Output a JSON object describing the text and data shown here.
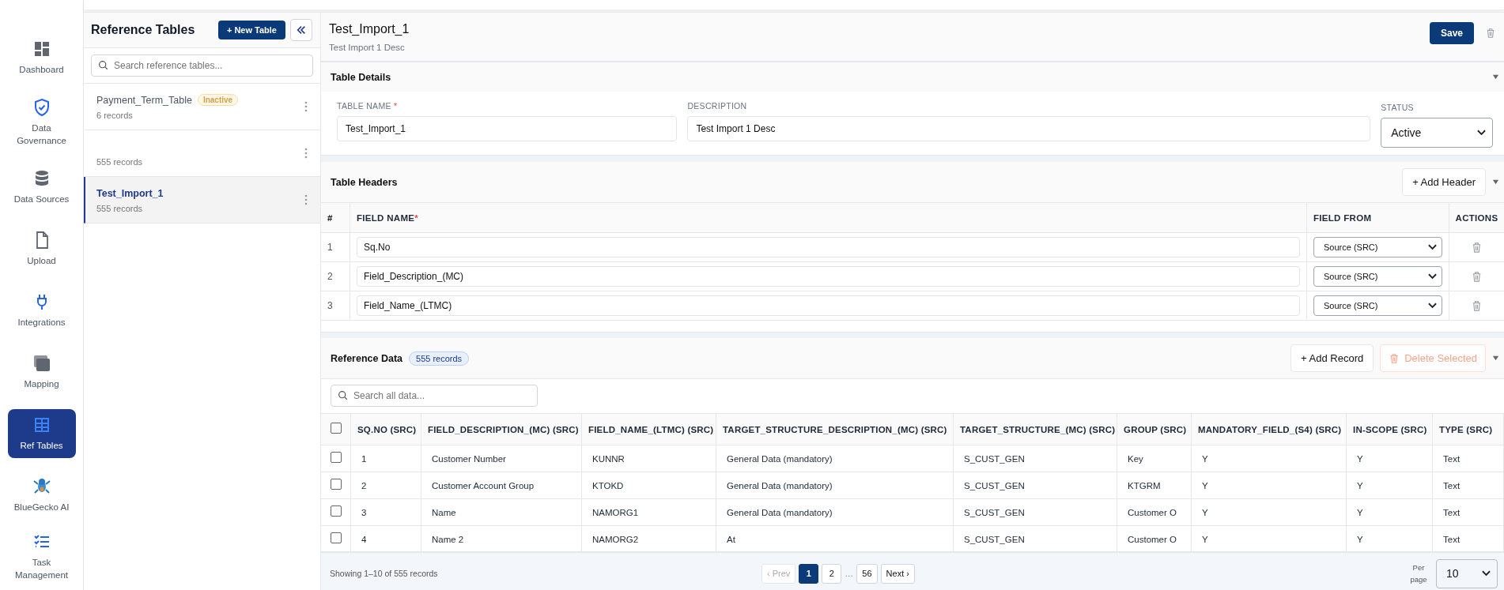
{
  "nav": [
    {
      "label": "Dashboard",
      "selected": false
    },
    {
      "label": "Data Governance",
      "selected": false
    },
    {
      "label": "Data Sources",
      "selected": false
    },
    {
      "label": "Upload",
      "selected": false
    },
    {
      "label": "Integrations",
      "selected": false
    },
    {
      "label": "Mapping",
      "selected": false
    },
    {
      "label": "Ref Tables",
      "selected": true
    },
    {
      "label": "BlueGecko AI",
      "selected": false
    },
    {
      "label": "Task Management",
      "selected": false
    }
  ],
  "list_panel": {
    "title": "Reference Tables",
    "new_button": "+ New Table",
    "search_placeholder": "Search reference tables...",
    "items": [
      {
        "title": "Payment_Term_Table",
        "badge": "Inactive",
        "records": "6 records",
        "selected": false
      },
      {
        "records": "555 records",
        "selected": false
      },
      {
        "title": "Test_Import_1",
        "records": "555 records",
        "selected": true
      }
    ]
  },
  "detail": {
    "title": "Test_Import_1",
    "description": "Test Import 1 Desc",
    "save_button": "Save"
  },
  "table_details": {
    "title": "Table Details",
    "expanded": true,
    "name_label": "TABLE NAME",
    "required_mark": "*",
    "name_value": "Test_Import_1",
    "description_label": "DESCRIPTION",
    "description_value": "Test Import 1 Desc",
    "status_label": "STATUS",
    "status_value": "Active"
  },
  "table_headers": {
    "title": "Table Headers",
    "expanded": true,
    "add_button": "+ Add Header",
    "columns": [
      "#",
      "FIELD NAME",
      "FIELD FROM",
      "ACTIONS"
    ],
    "required_mark": "*",
    "rows": [
      {
        "number": "1",
        "field_name": "Sq.No",
        "field_from": "Source (SRC)"
      },
      {
        "number": "2",
        "field_name": "Field_Description_(MC)",
        "field_from": "Source (SRC)"
      },
      {
        "number": "3",
        "field_name": "Field_Name_(LTMC)",
        "field_from": "Source (SRC)"
      }
    ]
  },
  "reference_data": {
    "title": "Reference Data",
    "count_badge": "555 records",
    "expanded": true,
    "add_button": "+ Add Record",
    "delete_button": {
      "label": "Delete Selected",
      "disabled": true
    },
    "search_placeholder": "Search all data...",
    "header_checked": false,
    "columns": [
      "SQ.NO (SRC)",
      "FIELD_DESCRIPTION_(MC) (SRC)",
      "FIELD_NAME_(LTMC) (SRC)",
      "TARGET_STRUCTURE_DESCRIPTION_(MC) (SRC)",
      "TARGET_STRUCTURE_(MC) (SRC)",
      "GROUP (SRC)",
      "MANDATORY_FIELD_(S4) (SRC)",
      "IN-SCOPE (SRC)",
      "TYPE (SRC)"
    ],
    "rows": [
      {
        "checked": false,
        "cells": [
          "1",
          "Customer Number",
          "KUNNR",
          "General Data (mandatory)",
          "S_CUST_GEN",
          "Key",
          "Y",
          "Y",
          "Text"
        ]
      },
      {
        "checked": false,
        "cells": [
          "2",
          "Customer Account Group",
          "KTOKD",
          "General Data (mandatory)",
          "S_CUST_GEN",
          "KTGRM",
          "Y",
          "Y",
          "Text"
        ]
      },
      {
        "checked": false,
        "cells": [
          "3",
          "Name",
          "NAMORG1",
          "General Data (mandatory)",
          "S_CUST_GEN",
          "Customer O",
          "Y",
          "Y",
          "Text"
        ]
      },
      {
        "checked": false,
        "cells": [
          "4",
          "Name 2",
          "NAMORG2",
          "At",
          "S_CUST_GEN",
          "Customer O",
          "Y",
          "Y",
          "Text"
        ]
      }
    ]
  },
  "footer": {
    "showing": "Showing 1–10 of 555 records",
    "prev": {
      "label": "‹ Prev",
      "disabled": true
    },
    "pages": [
      {
        "label": "1",
        "selected": true
      },
      {
        "label": "2",
        "selected": false
      },
      {
        "label": "…",
        "kind": "ellipsis"
      },
      {
        "label": "56",
        "selected": false
      }
    ],
    "next": "Next ›",
    "per_page_label": "Per page",
    "per_page_value": "10"
  }
}
